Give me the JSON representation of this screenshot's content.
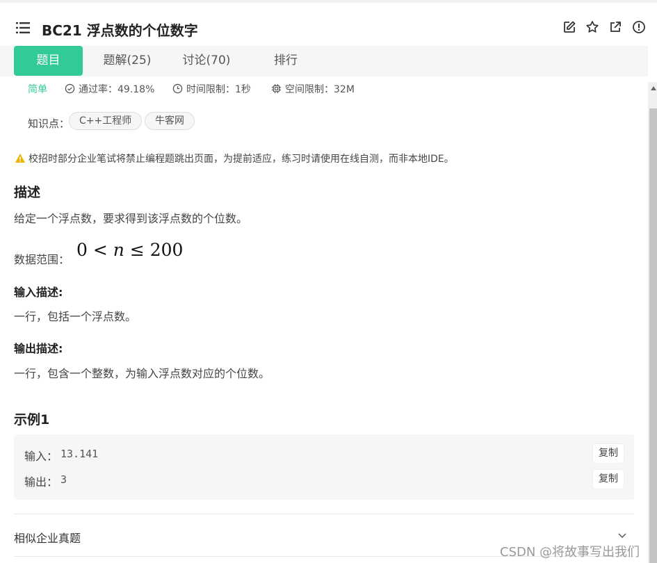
{
  "header": {
    "title": "BC21  浮点数的个位数字",
    "icons": [
      "menu-icon",
      "edit-icon",
      "star-icon",
      "external-link-icon",
      "info-icon"
    ]
  },
  "tabs": [
    {
      "label": "题目"
    },
    {
      "label": "题解(25)"
    },
    {
      "label": "讨论(70)"
    },
    {
      "label": "排行"
    }
  ],
  "meta": {
    "difficulty": "简单",
    "pass_rate": "通过率：49.18%",
    "time_limit": "时间限制：1秒",
    "space_limit": "空间限制：32M"
  },
  "knowledge": {
    "label": "知识点：",
    "tags": [
      "C++工程师",
      "牛客网"
    ]
  },
  "warning": "校招时部分企业笔试将禁止编程题跳出页面，为提前适应，练习时请使用在线自测，而非本地IDE。",
  "description": {
    "heading": "描述",
    "text": "给定一个浮点数，要求得到该浮点数的个位数。",
    "range_label": "数据范围：",
    "range_math": {
      "lhs": "0 <",
      "var": "n",
      "rhs": "≤ 200"
    }
  },
  "input_desc": {
    "heading": "输入描述:",
    "text": "一行，包括一个浮点数。"
  },
  "output_desc": {
    "heading": "输出描述:",
    "text": "一行，包含一个整数，为输入浮点数对应的个位数。"
  },
  "example": {
    "heading": "示例1",
    "input_label": "输入：",
    "input_value": "13.141",
    "output_label": "输出：",
    "output_value": "3",
    "copy_label": "复制"
  },
  "similar": {
    "label": "相似企业真题"
  },
  "watermark": "CSDN @将故事写出我们",
  "colors": {
    "accent": "#32ca99",
    "warning": "#f0b400"
  }
}
